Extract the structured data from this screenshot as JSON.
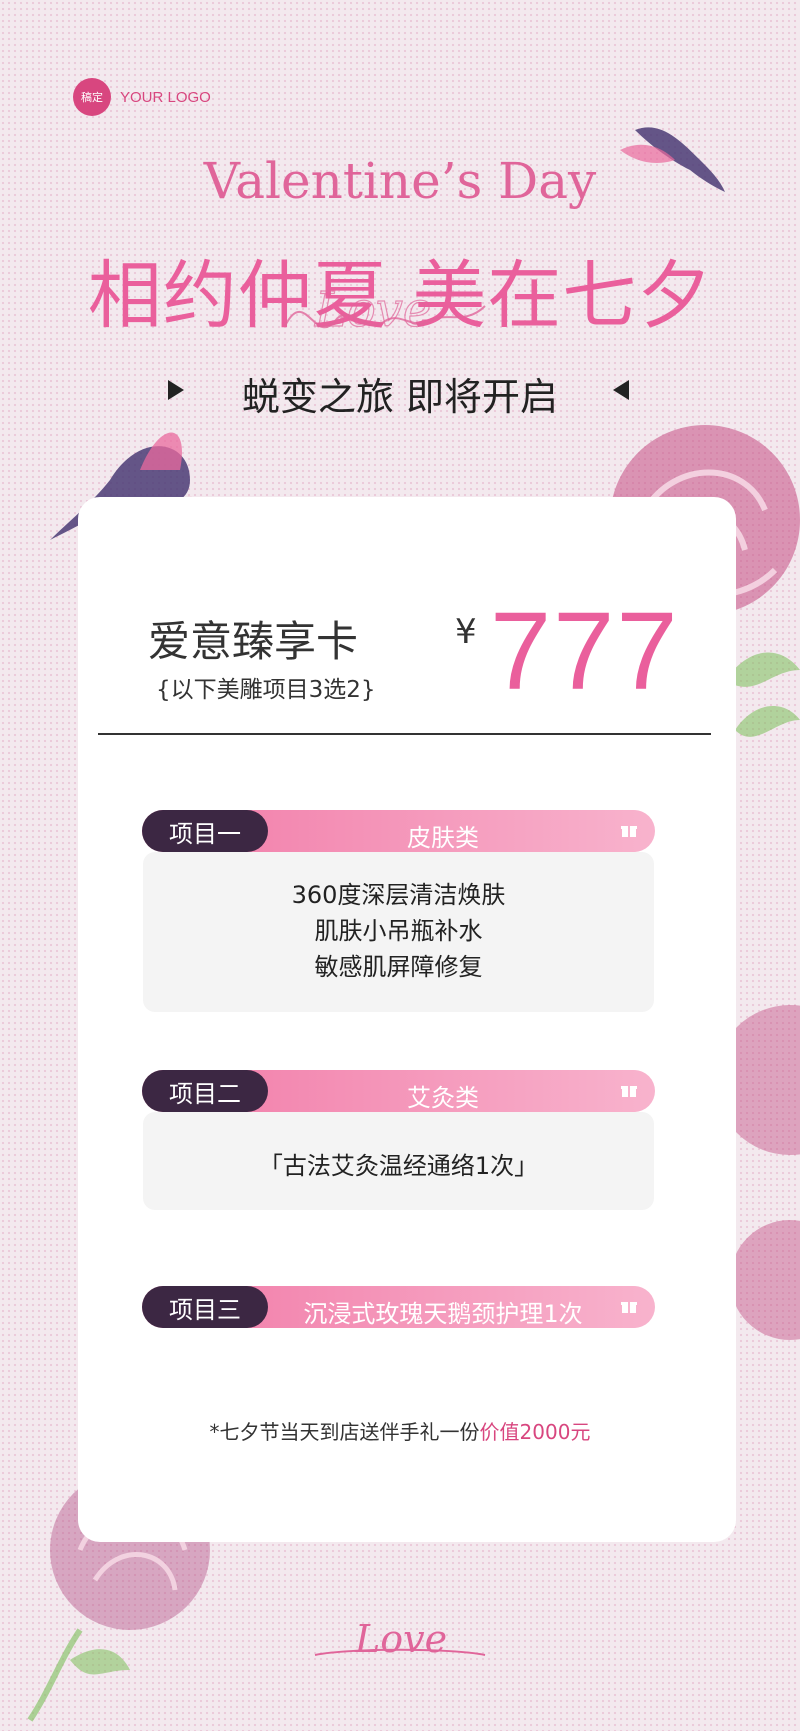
{
  "logo": {
    "badge_text": "稿定",
    "text": "YOUR LOGO"
  },
  "header": {
    "english_title": "Valentine’s Day",
    "headline": "相约仲夏 美在七夕",
    "script_word": "Love",
    "subline": "蜕变之旅 即将开启"
  },
  "card": {
    "title": "爱意臻享卡",
    "subtitle": "{以下美雕项目3选2}",
    "currency": "¥",
    "price": "777"
  },
  "items": [
    {
      "label": "项目一",
      "category": "皮肤类",
      "lines": [
        "360度深层清洁焕肤",
        "肌肤小吊瓶补水",
        "敏感肌屏障修复"
      ]
    },
    {
      "label": "项目二",
      "category": "艾灸类",
      "lines": [
        "「古法艾灸温经通络1次」"
      ]
    },
    {
      "label": "项目三",
      "category": "沉浸式玫瑰天鹅颈护理1次",
      "lines": []
    }
  ],
  "note": {
    "text": "*七夕节当天到店送伴手礼一份",
    "highlight": "价值2000元"
  },
  "footer": {
    "script_word": "Love"
  },
  "colors": {
    "accent_pink": "#ea5f9c",
    "dark_purple": "#3c2743",
    "panel_gray": "#f4f4f4"
  }
}
